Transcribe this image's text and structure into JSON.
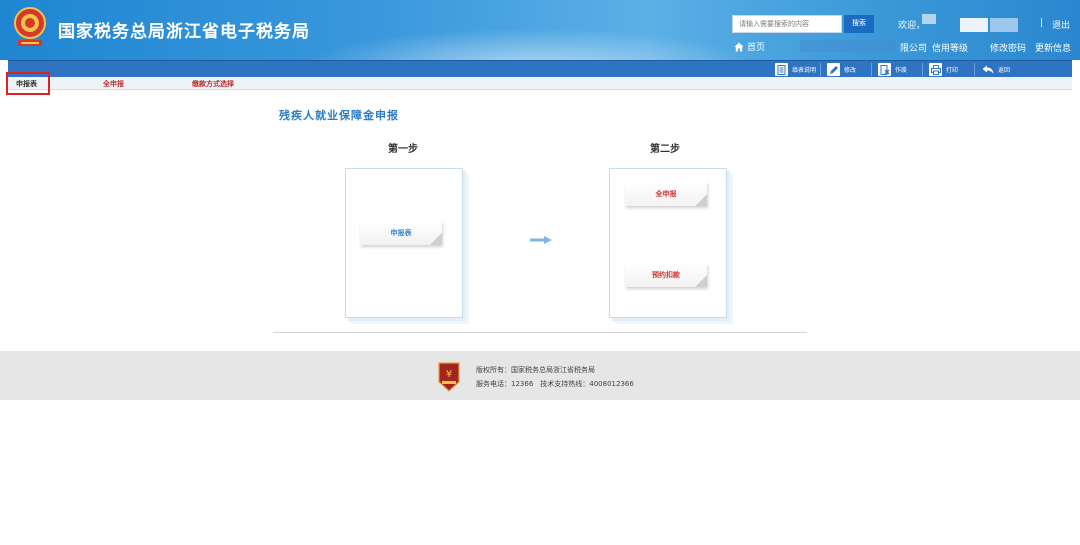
{
  "header": {
    "site_title": "国家税务总局浙江省电子税务局",
    "search_placeholder": "请输入需要搜索的内容",
    "search_button": "搜索",
    "welcome": "欢迎，",
    "separator": "|",
    "logout": "退出",
    "home": "首页",
    "company_suffix": "限公司",
    "credit_label": "信用等级",
    "change_password": "修改密码",
    "update_info": "更新信息"
  },
  "toolbar": {
    "items": [
      {
        "label": "填表说明",
        "icon": "document-icon"
      },
      {
        "label": "修改",
        "icon": "pencil-icon"
      },
      {
        "label": "作废",
        "icon": "void-icon"
      },
      {
        "label": "打印",
        "icon": "printer-icon"
      },
      {
        "label": "返回",
        "icon": "back-arrow-icon"
      }
    ]
  },
  "tabs": [
    {
      "label": "申报表",
      "active": true
    },
    {
      "label": "全申报",
      "active": false
    },
    {
      "label": "缴款方式选择",
      "active": false
    }
  ],
  "main": {
    "title": "残疾人就业保障金申报",
    "step1": {
      "label": "第一步",
      "cards": [
        {
          "label": "申报表"
        }
      ]
    },
    "step2": {
      "label": "第二步",
      "cards": [
        {
          "label": "全申报"
        },
        {
          "label": "预约扣款"
        }
      ]
    }
  },
  "footer": {
    "copyright": "版权所有：国家税务总局浙江省税务局",
    "service": "服务电话：12366　技术支持热线：4008012366"
  },
  "colors": {
    "header_blue": "#2a87cf",
    "toolbar_blue": "#2e74c2",
    "tab_red": "#b8312f",
    "highlight_red": "#e02020",
    "title_blue": "#2d7dc7"
  }
}
